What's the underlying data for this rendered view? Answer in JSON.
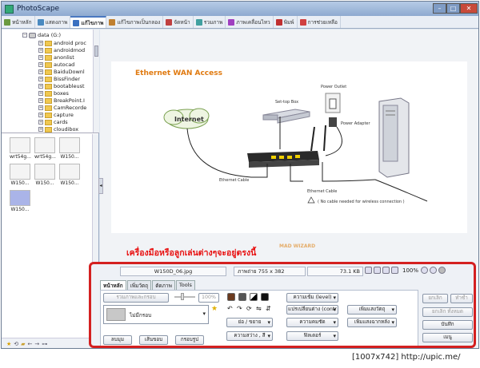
{
  "window": {
    "title": "PhotoScape",
    "controls": [
      "–",
      "□",
      "✕"
    ]
  },
  "tabs": [
    {
      "label": "หน้าหลัก",
      "icon": "home-icon",
      "color": "#6a9a40"
    },
    {
      "label": "แสดงภาพ",
      "icon": "viewer-icon",
      "color": "#4a8ac0"
    },
    {
      "label": "แก้ไขภาพ",
      "icon": "editor-icon",
      "color": "#3a70c0",
      "active": true
    },
    {
      "label": "แก้ไขภาพเป็นกลอง",
      "icon": "batch-icon",
      "color": "#c08030"
    },
    {
      "label": "จัดหน้า",
      "icon": "page-icon",
      "color": "#c04040"
    },
    {
      "label": "รวมภาพ",
      "icon": "combine-icon",
      "color": "#40a0a0"
    },
    {
      "label": "ภาพเคลื่อนไหว",
      "icon": "gif-icon",
      "color": "#a040c0"
    },
    {
      "label": "พิมพ์",
      "icon": "print-icon",
      "color": "#c03030"
    },
    {
      "label": "การช่วยเหลือ",
      "icon": "help-icon",
      "color": "#d04040"
    }
  ],
  "tree": {
    "root": "data (G:)",
    "folders": [
      "android proc",
      "androidmod",
      "anonlist",
      "autocad",
      "BaiduDownl",
      "BissFinder",
      "bootableust",
      "boxes",
      "BreakPoint.I",
      "CamRecorde",
      "capture",
      "cards",
      "cloudibox"
    ]
  },
  "thumbnails": [
    "wrt54g...",
    "wrt54g...",
    "W150...",
    "W150...",
    "W150...",
    "W150...",
    "W150..."
  ],
  "diagram": {
    "title": "Ethernet WAN Access",
    "internet": "Internet",
    "settop": "Set-top Box",
    "outlet": "Power Outlet",
    "adapter": "Power Adapter",
    "cable1": "Ethernet Cable",
    "cable2": "Ethernet Cable",
    "note": "( No cable needed  for wireless connection )"
  },
  "caption": "เครื่องมือหรือลูกเล่นต่างๆจะอยู่ตรงนี้",
  "watermark": "MAD WIZARD",
  "info": {
    "filename": "W150D_06.jpg",
    "dimensions": "ภาพถ่าย 755 x 382",
    "filesize": "73.1 KB",
    "zoom": "100%"
  },
  "subtabs": [
    "หน้าหลัก",
    "เพิ่มวัตถุ",
    "ตัดภาพ",
    "Tools"
  ],
  "controls": {
    "resize_btn": "รวมภาพและกรอบ",
    "percent": "100%",
    "frame_select": "ไม่มีกรอบ",
    "brightness": "ความเข้ม (level)",
    "contrast": "แปรเปลี่ยนต่าง (contr",
    "sharpen": "ความคมชัด",
    "filter": "ฟิลเตอร์",
    "size": "ย่อ / ขยาย",
    "brightness_color": "ความสว่าง , สี",
    "add_light": "เพิ่มแสงวัตถุ",
    "add_bg_light": "เพิ่มแสงฉากหลัง",
    "rounded": "ลบมุม",
    "margin": "เส้นขอบ",
    "frame_line": "กรอบรูป"
  },
  "right_buttons": {
    "undo": "ยกเลิก",
    "redo": "ทำซ้ำ",
    "undo_all": "ยกเลิก ทั้งหมด",
    "save": "บันทึก",
    "menu": "เมนู"
  },
  "footer": "[1007x742] http://upic.me/"
}
